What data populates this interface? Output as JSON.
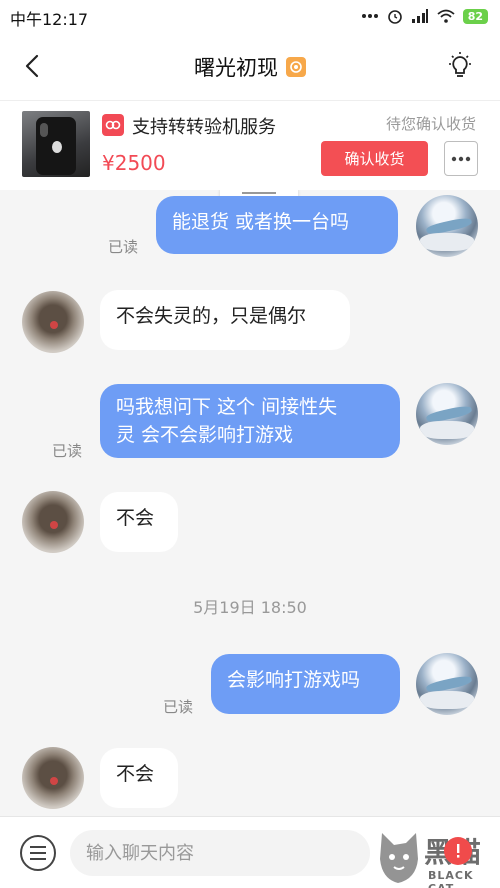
{
  "status_bar": {
    "time": "中午12:17",
    "battery": "82"
  },
  "header": {
    "title": "曙光初现"
  },
  "product": {
    "service_label": "支持转转验机服务",
    "price": "¥2500",
    "status": "待您确认收货",
    "confirm_button": "确认收货"
  },
  "chat": {
    "read_label": "已读",
    "messages": [
      {
        "direction": "out",
        "text": "能退货 或者换一台吗",
        "read": true
      },
      {
        "direction": "in",
        "text": "不会失灵的，只是偶尔"
      },
      {
        "direction": "out",
        "text_line1": "吗我想问下 这个 间接性失",
        "text_line2": "灵 会不会影响打游戏",
        "read": true
      },
      {
        "direction": "in",
        "text": "不会"
      },
      {
        "direction": "out",
        "text": "会影响打游戏吗",
        "read": true
      },
      {
        "direction": "in",
        "text": "不会"
      }
    ],
    "timestamp": "5月19日 18:50"
  },
  "input": {
    "placeholder": "输入聊天内容"
  },
  "watermark": {
    "brand": "黑猫",
    "sub": "BLACK CAT"
  },
  "colors": {
    "accent_red": "#f34f54",
    "outgoing_bubble": "#6e9df5"
  }
}
